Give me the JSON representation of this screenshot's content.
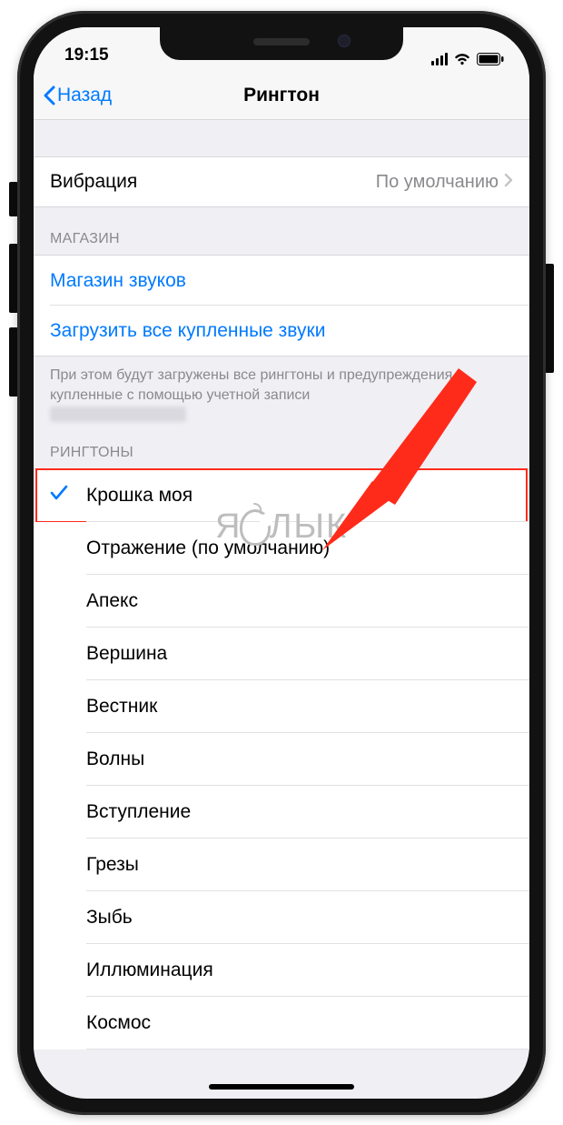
{
  "statusbar": {
    "time": "19:15"
  },
  "navbar": {
    "back": "Назад",
    "title": "Рингтон"
  },
  "vibration": {
    "label": "Вибрация",
    "value": "По умолчанию"
  },
  "store": {
    "header": "МАГАЗИН",
    "tone_store": "Магазин звуков",
    "download_all": "Загрузить все купленные звуки",
    "footer": "При этом будут загружены все рингтоны и предупреждения, купленные с помощью учетной записи"
  },
  "ringtones": {
    "header": "РИНГТОНЫ",
    "selected_index": 0,
    "items": [
      "Крошка моя",
      "Отражение (по умолчанию)",
      "Апекс",
      "Вершина",
      "Вестник",
      "Волны",
      "Вступление",
      "Грезы",
      "Зыбь",
      "Иллюминация",
      "Космос"
    ]
  },
  "watermark": {
    "left": "Я",
    "right": "ЛЫК"
  },
  "colors": {
    "link": "#007aff",
    "annotation": "#ff2b1a"
  }
}
